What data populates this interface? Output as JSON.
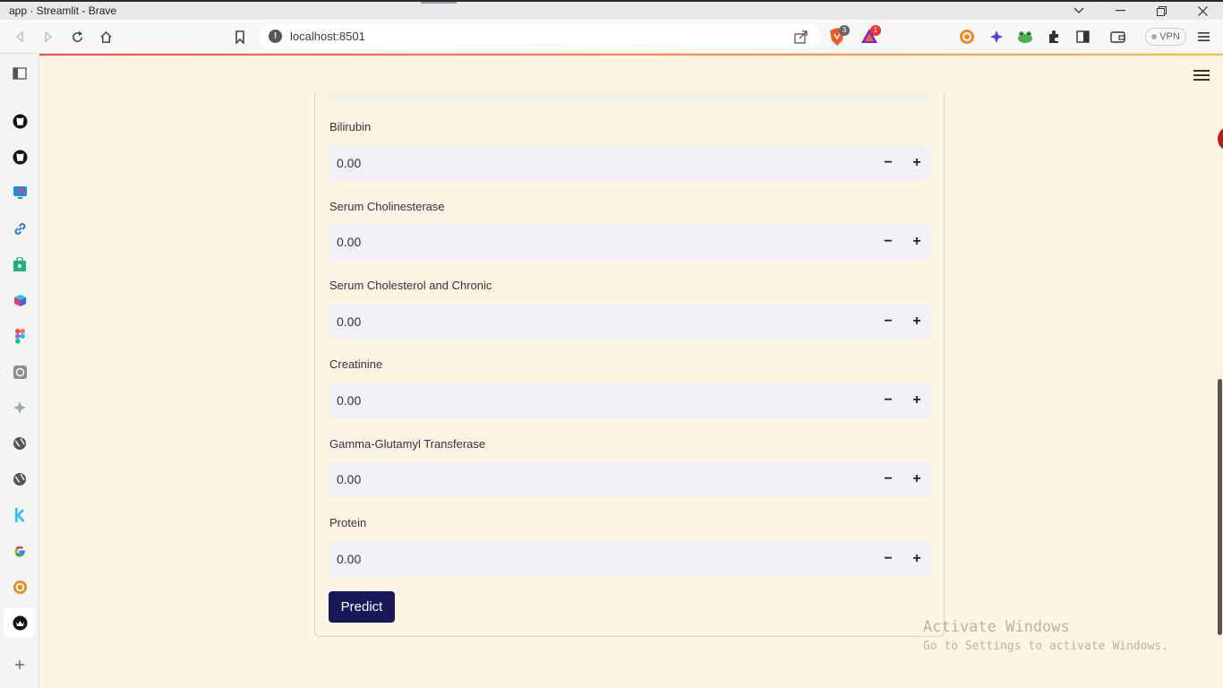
{
  "window": {
    "title": "app · Streamlit - Brave"
  },
  "toolbar": {
    "url": "localhost:8501",
    "shields_count": "3",
    "rewards_count": "1",
    "vpn_label": "VPN"
  },
  "sidebar": {
    "items": [
      "github",
      "github",
      "app",
      "link",
      "bag",
      "cube",
      "figma",
      "openai",
      "sparkle",
      "globe",
      "globe",
      "kaggle",
      "google",
      "duckduckgo",
      "active-app"
    ]
  },
  "form": {
    "fields": [
      {
        "label": "Bilirubin",
        "value": "0.00"
      },
      {
        "label": "Serum Cholinesterase",
        "value": "0.00"
      },
      {
        "label": "Serum Cholesterol and Chronic",
        "value": "0.00"
      },
      {
        "label": "Creatinine",
        "value": "0.00"
      },
      {
        "label": "Gamma-Glutamyl Transferase",
        "value": "0.00"
      },
      {
        "label": "Protein",
        "value": "0.00"
      }
    ],
    "predict_label": "Predict",
    "minus_symbol": "−",
    "plus_symbol": "+"
  },
  "watermark": {
    "line1": "Activate Windows",
    "line2": "Go to Settings to activate Windows."
  },
  "colors": {
    "page_bg": "#fdf4e3",
    "input_bg": "#f0f2f6",
    "button_bg": "#181757",
    "accent_start": "#ff4b4b",
    "accent_end": "#ffbd45"
  }
}
